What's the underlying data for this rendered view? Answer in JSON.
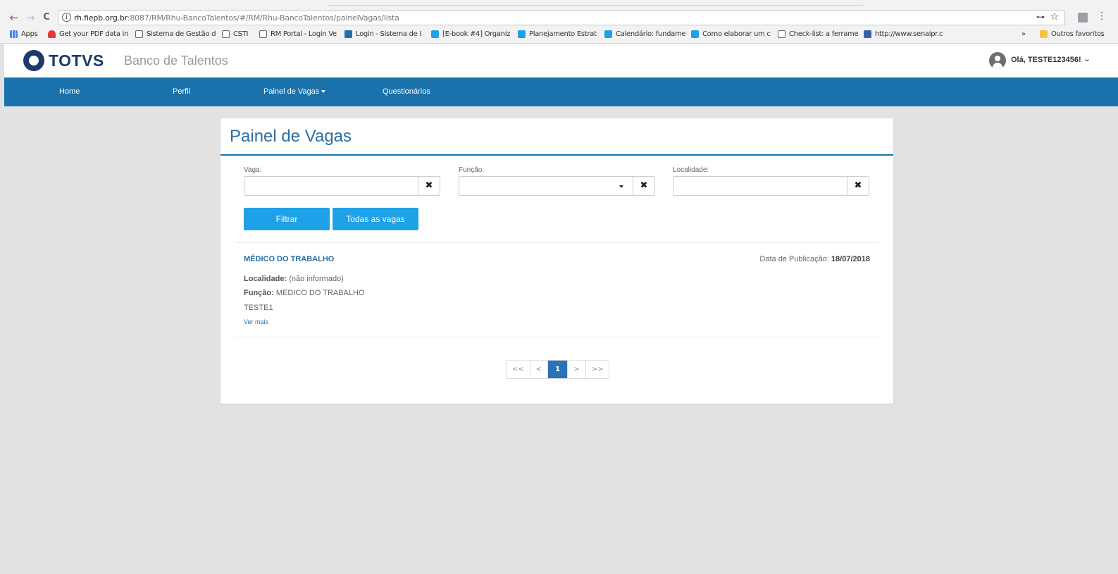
{
  "browser": {
    "url_host": "rh.fiepb.org.br",
    "url_path": ":8087/RM/Rhu-BancoTalentos/#/RM/Rhu-BancoTalentos/painelVagas/lista",
    "info_glyph": "i",
    "back_glyph": "←",
    "forward_glyph": "→",
    "reload_glyph": "C",
    "key_glyph": "⊶",
    "star_glyph": "☆",
    "menu_glyph": "⋮",
    "bookmarks": [
      {
        "label": "Apps",
        "icon": "apps-grid-icon"
      },
      {
        "label": "Get your PDF data in",
        "icon": "heart-icon"
      },
      {
        "label": "Sistema de Gestão d",
        "icon": "document-icon"
      },
      {
        "label": "CSTI",
        "icon": "document-icon"
      },
      {
        "label": "RM Portal - Login Ve",
        "icon": "document-icon"
      },
      {
        "label": "Login - Sistema de I",
        "icon": "blue-logo-icon"
      },
      {
        "label": "[E-book #4] Organiz",
        "icon": "cyan-logo-icon"
      },
      {
        "label": "Planejamento Estrat",
        "icon": "cyan-logo-icon"
      },
      {
        "label": "Calendário: fundame",
        "icon": "cyan-logo-icon"
      },
      {
        "label": "Como elaborar um c",
        "icon": "cyan-logo-icon"
      },
      {
        "label": "Check-list: a ferrame",
        "icon": "document-icon"
      },
      {
        "label": "http://www.senaipr.c",
        "icon": "senai-logo-icon"
      }
    ],
    "bookmarks_overflow": "»",
    "other_bookmarks": "Outros favoritos"
  },
  "header": {
    "logo_text": "TOTVS",
    "app_title": "Banco de Talentos",
    "user_greeting": "Olá, TESTE123456!",
    "user_chevron": "⌄"
  },
  "nav": {
    "home": "Home",
    "profile": "Perfil",
    "jobs_panel": "Painel de Vagas",
    "questionnaires": "Questionários"
  },
  "panel": {
    "title": "Painel de Vagas",
    "filters": {
      "vaga_label": "Vaga:",
      "vaga_value": "",
      "funcao_label": "Função:",
      "funcao_value": "",
      "localidade_label": "Localidade:",
      "localidade_value": "",
      "clear_glyph": "✖"
    },
    "buttons": {
      "filter": "Filtrar",
      "all_jobs": "Todas as vagas"
    },
    "job": {
      "title": "MÉDICO DO TRABALHO",
      "pub_label": "Data de Publicação:",
      "pub_date": "18/07/2018",
      "locality_label": "Localidade:",
      "locality_value": "(não informado)",
      "function_label": "Função:",
      "function_value": "MEDICO DO TRABALHO",
      "description": "TESTE1",
      "more": "Ver mais"
    },
    "pagination": {
      "first": "<<",
      "prev": "<",
      "current": "1",
      "next": ">",
      "last": ">>"
    }
  },
  "colors": {
    "nav_bar": "#1a72ac",
    "button": "#1ea1e6",
    "title": "#2a6ea3",
    "page_bg": "#e2e2e2"
  }
}
